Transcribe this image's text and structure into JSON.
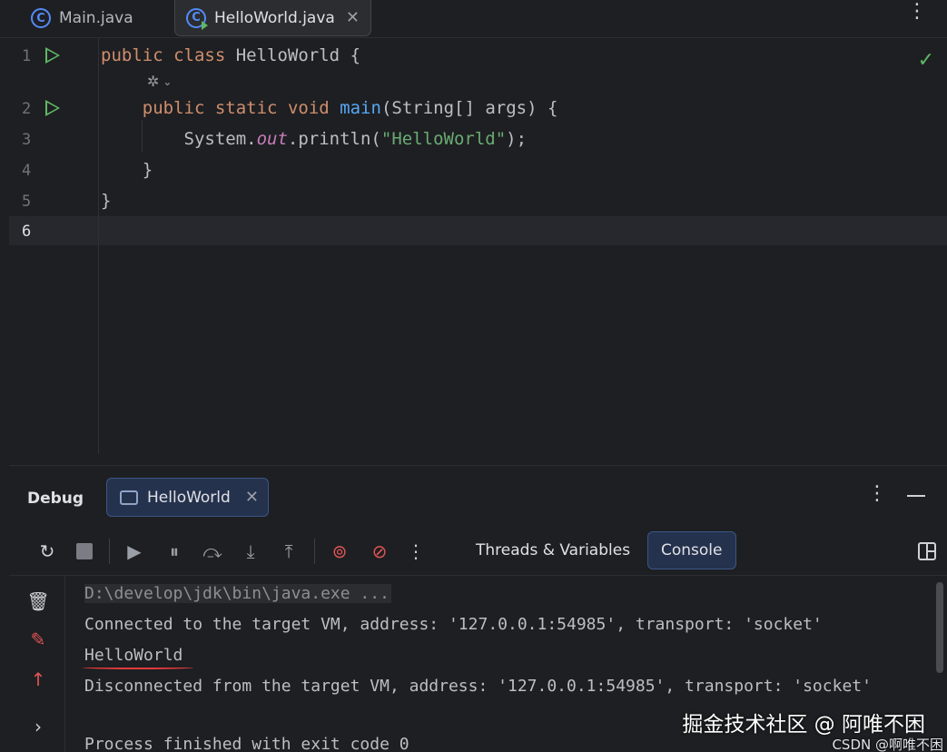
{
  "tabs": [
    {
      "label": "Main.java",
      "icon": "java-class-icon",
      "active": false
    },
    {
      "label": "HelloWorld.java",
      "icon": "java-class-run-icon",
      "active": true
    }
  ],
  "editor": {
    "line_numbers": [
      "1",
      "2",
      "3",
      "4",
      "5",
      "6"
    ],
    "lines": {
      "l1_kw1": "public",
      "l1_kw2": "class",
      "l1_rest": " HelloWorld {",
      "l2_kw1": "public",
      "l2_kw2": "static",
      "l2_kw3": "void",
      "l2_fn": "main",
      "l2_rest": "(String[] args) {",
      "l3_a": "System.",
      "l3_field": "out",
      "l3_b": ".println(",
      "l3_str": "\"HelloWorld\"",
      "l3_c": ");",
      "l4": "}",
      "l5": "}"
    },
    "status_icon": "checkmark-icon"
  },
  "debug": {
    "title": "Debug",
    "session_label": "HelloWorld",
    "toolbar_tabs": {
      "threads": "Threads & Variables",
      "console": "Console"
    },
    "active_tab": "Console",
    "console_lines": {
      "cmd": "D:\\develop\\jdk\\bin\\java.exe ...",
      "connected": "Connected to the target VM, address: '127.0.0.1:54985', transport: 'socket'",
      "output": "HelloWorld",
      "disconnected": "Disconnected from the target VM, address: '127.0.0.1:54985', transport: 'socket'",
      "process": "Process finished with exit code 0"
    }
  },
  "watermark": {
    "main": "掘金技术社区 @ 阿唯不困",
    "sub": "CSDN @啊唯不困"
  },
  "colors": {
    "accent": "#548af7",
    "run": "#5fb865",
    "keyword": "#cf8e6d",
    "string": "#6aab73",
    "function": "#56a8f5",
    "highlight": "#e03b3b"
  }
}
